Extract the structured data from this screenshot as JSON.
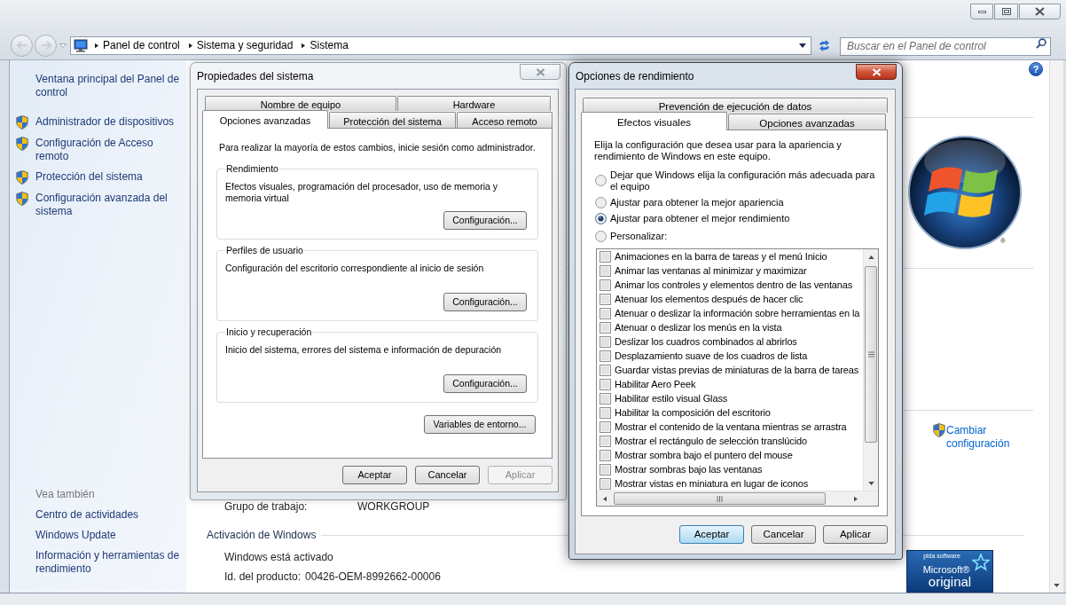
{
  "window": {
    "breadcrumb": [
      "Panel de control",
      "Sistema y seguridad",
      "Sistema"
    ],
    "search": {
      "placeholder": "Buscar en el Panel de control"
    },
    "help": "?"
  },
  "sidebar": {
    "items": [
      {
        "label": "Ventana principal del Panel de control",
        "kind": "link"
      },
      {
        "label": "Administrador de dispositivos",
        "kind": "shield"
      },
      {
        "label": "Configuración de Acceso remoto",
        "kind": "shield"
      },
      {
        "label": "Protección del sistema",
        "kind": "shield"
      },
      {
        "label": "Configuración avanzada del sistema",
        "kind": "shield"
      }
    ],
    "see_also": {
      "heading": "Vea también",
      "items": [
        "Centro de actividades",
        "Windows Update",
        "Información y herramientas de rendimiento"
      ]
    }
  },
  "main": {
    "workgroup": {
      "label": "Grupo de trabajo:",
      "value": "WORKGROUP"
    },
    "activation": {
      "heading": "Activación de Windows",
      "status": "Windows está activado",
      "product_id": {
        "label": "Id. del producto:",
        "value": "00426-OEM-8992662-00006"
      }
    },
    "logo_mark": "®",
    "change_settings": "Cambiar configuración",
    "genuine_badge": {
      "tagline": "pida software",
      "brand": "Microsoft®",
      "word": "original"
    }
  },
  "system_properties": {
    "title": "Propiedades del sistema",
    "active": false,
    "tab_rows": [
      {
        "tabs": [
          {
            "label": "Nombre de equipo",
            "selected": false
          },
          {
            "label": "Hardware",
            "selected": false
          }
        ]
      },
      {
        "tabs": [
          {
            "label": "Opciones avanzadas",
            "selected": true
          },
          {
            "label": "Protección del sistema",
            "selected": false
          },
          {
            "label": "Acceso remoto",
            "selected": false
          }
        ]
      }
    ],
    "notice": "Para realizar la mayoría de estos cambios, inicie sesión como administrador.",
    "groups": [
      {
        "title": "Rendimiento",
        "text": "Efectos visuales, programación del procesador, uso de memoria y memoria virtual",
        "button": "Configuración..."
      },
      {
        "title": "Perfiles de usuario",
        "text": "Configuración del escritorio correspondiente al inicio de sesión",
        "button": "Configuración..."
      },
      {
        "title": "Inicio y recuperación",
        "text": "Inicio del sistema, errores del sistema e información de depuración",
        "button": "Configuración..."
      }
    ],
    "env_button": "Variables de entorno...",
    "buttons": [
      {
        "label": "Aceptar",
        "default": false,
        "disabled": false
      },
      {
        "label": "Cancelar",
        "default": false,
        "disabled": false
      },
      {
        "label": "Aplicar",
        "default": false,
        "disabled": true
      }
    ]
  },
  "performance_options": {
    "title": "Opciones de rendimiento",
    "active": true,
    "tab_rows": [
      {
        "tabs": [
          {
            "label": "Prevención de ejecución de datos",
            "selected": false
          }
        ]
      },
      {
        "tabs": [
          {
            "label": "Efectos visuales",
            "selected": true
          },
          {
            "label": "Opciones avanzadas",
            "selected": false
          }
        ]
      }
    ],
    "description": "Elija la configuración que desea usar para la apariencia y rendimiento de Windows en este equipo.",
    "options": [
      {
        "label": "Dejar que Windows elija la configuración más adecuada para el equipo",
        "selected": false
      },
      {
        "label": "Ajustar para obtener la mejor apariencia",
        "selected": false
      },
      {
        "label": "Ajustar para obtener el mejor rendimiento",
        "selected": true
      },
      {
        "label": "Personalizar:",
        "selected": false
      }
    ],
    "effects": [
      {
        "label": "Animaciones en la barra de tareas y el menú Inicio",
        "checked": false
      },
      {
        "label": "Animar las ventanas al minimizar y maximizar",
        "checked": false
      },
      {
        "label": "Animar los controles y elementos dentro de las ventanas",
        "checked": false
      },
      {
        "label": "Atenuar los elementos después de hacer clic",
        "checked": false
      },
      {
        "label": "Atenuar o deslizar la información sobre herramientas en la",
        "checked": false
      },
      {
        "label": "Atenuar o deslizar los menús en la vista",
        "checked": false
      },
      {
        "label": "Deslizar los cuadros combinados al abrirlos",
        "checked": false
      },
      {
        "label": "Desplazamiento suave de los cuadros de lista",
        "checked": false
      },
      {
        "label": "Guardar vistas previas de miniaturas de la barra de tareas",
        "checked": false
      },
      {
        "label": "Habilitar Aero Peek",
        "checked": false
      },
      {
        "label": "Habilitar estilo visual Glass",
        "checked": false
      },
      {
        "label": "Habilitar la composición del escritorio",
        "checked": false
      },
      {
        "label": "Mostrar el contenido de la ventana mientras se arrastra",
        "checked": false
      },
      {
        "label": "Mostrar el rectángulo de selección translúcido",
        "checked": false
      },
      {
        "label": "Mostrar sombra bajo el puntero del mouse",
        "checked": false
      },
      {
        "label": "Mostrar sombras bajo las ventanas",
        "checked": false
      },
      {
        "label": "Mostrar vistas en miniatura en lugar de iconos",
        "checked": false
      }
    ],
    "buttons": [
      {
        "label": "Aceptar",
        "default": true,
        "disabled": false
      },
      {
        "label": "Cancelar",
        "default": false,
        "disabled": false
      },
      {
        "label": "Aplicar",
        "default": false,
        "disabled": false
      }
    ]
  }
}
